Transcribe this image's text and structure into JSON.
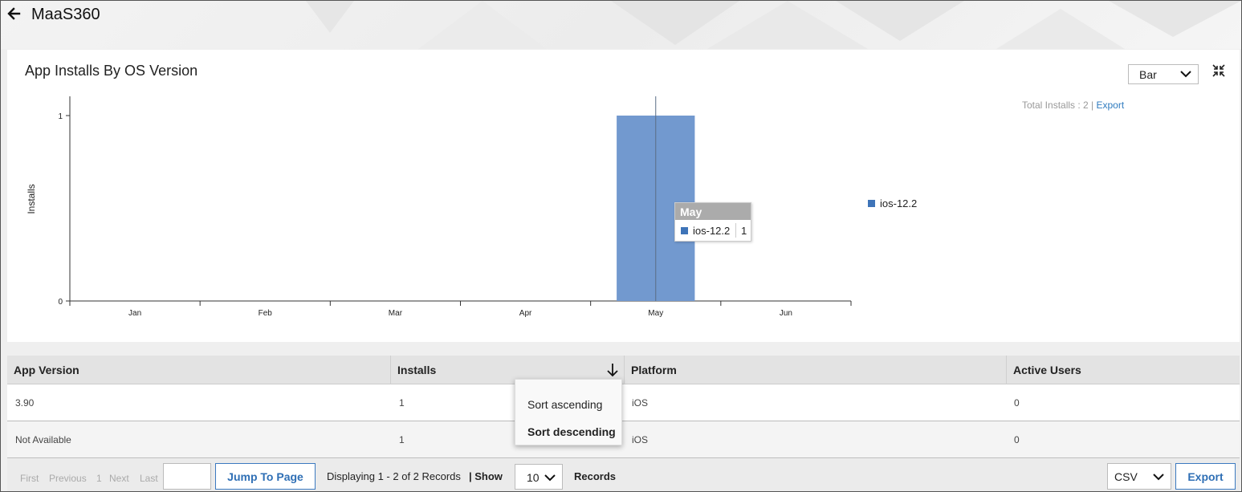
{
  "header": {
    "title": "MaaS360",
    "back_icon": "arrow-left-icon"
  },
  "panel": {
    "title": "App Installs By OS Version",
    "chart_type_selected": "Bar",
    "total_label": "Total Installs : 2 |",
    "export_link": "Export",
    "collapse_icon": "collapse-icon"
  },
  "chart_data": {
    "type": "bar",
    "categories": [
      "Jan",
      "Feb",
      "Mar",
      "Apr",
      "May",
      "Jun"
    ],
    "series": [
      {
        "name": "ios-12.2",
        "values": [
          0,
          0,
          0,
          0,
          1,
          0
        ],
        "color": "#7299cf"
      }
    ],
    "ylabel": "Installs",
    "ylim": [
      0,
      1
    ],
    "yticks": [
      "0",
      "1"
    ],
    "legend": "right",
    "legend_color": "#3e74b8",
    "tooltip": {
      "title": "May",
      "series": "ios-12.2",
      "value": "1"
    }
  },
  "table": {
    "columns": [
      "App Version",
      "Installs",
      "Platform",
      "Active Users"
    ],
    "rows": [
      [
        "3.90",
        "1",
        "iOS",
        "0"
      ],
      [
        "Not Available",
        "1",
        "iOS",
        "0"
      ]
    ],
    "sort_icon": "arrow-down-icon",
    "sort_menu": {
      "ascending": "Sort ascending",
      "descending": "Sort descending"
    }
  },
  "pager": {
    "first": "First",
    "previous": "Previous",
    "page": "1",
    "next": "Next",
    "last": "Last",
    "page_input": "",
    "jump_label": "Jump To Page",
    "displaying": "Displaying 1 - 2 of 2 Records",
    "show_label": "| Show",
    "per_page": "10",
    "records_label": "Records",
    "format": "CSV",
    "export_label": "Export"
  }
}
